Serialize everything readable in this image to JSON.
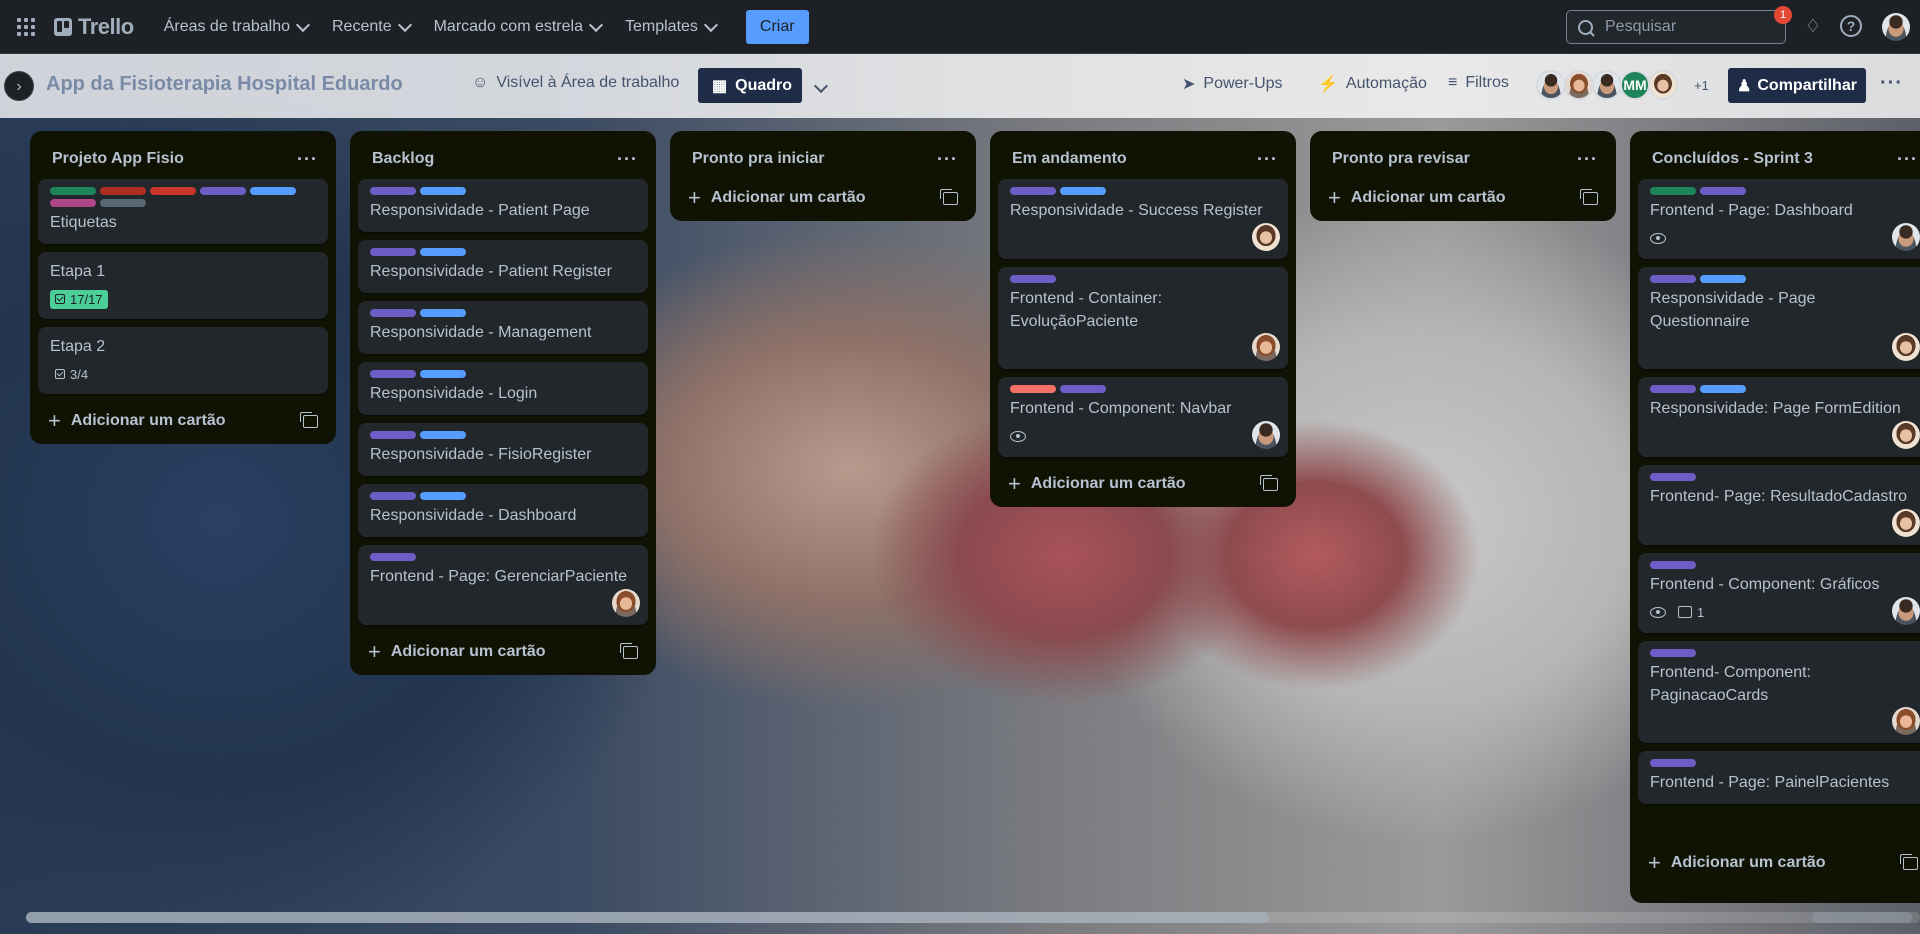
{
  "topbar": {
    "brand": "Trello",
    "nav": [
      "Áreas de trabalho",
      "Recente",
      "Marcado com estrela",
      "Templates"
    ],
    "create_label": "Criar",
    "search_placeholder": "Pesquisar",
    "notifications_count": "1"
  },
  "board": {
    "title": "App da Fisioterapia Hospital Eduardo",
    "visibility": "Visível à Área de trabalho",
    "view": "Quadro",
    "powerups": "Power-Ups",
    "automation": "Automação",
    "filters": "Filtros",
    "members_initials": "MM",
    "members_more": "+1",
    "share": "Compartilhar"
  },
  "colors": {
    "green": "#1f845a",
    "red_dark": "#ae2e24",
    "red": "#c9372c",
    "purple": "#6e5dc6",
    "blue": "#579dff",
    "magenta": "#ae4787",
    "gray": "#596773",
    "coral": "#f87168"
  },
  "add_card_label": "Adicionar um cartão",
  "lists": [
    {
      "title": "Projeto App Fisio",
      "cards": [
        {
          "title": "Etiquetas",
          "labels": [
            "green",
            "red_dark",
            "red",
            "purple",
            "blue",
            "magenta",
            "gray"
          ]
        },
        {
          "title": "Etapa 1",
          "checklist": "17/17",
          "checklist_done": true
        },
        {
          "title": "Etapa 2",
          "checklist": "3/4"
        }
      ]
    },
    {
      "title": "Backlog",
      "cards": [
        {
          "title": "Responsividade - Patient Page",
          "labels": [
            "purple",
            "blue"
          ]
        },
        {
          "title": "Responsividade - Patient Register",
          "labels": [
            "purple",
            "blue"
          ]
        },
        {
          "title": "Responsividade - Management",
          "labels": [
            "purple",
            "blue"
          ]
        },
        {
          "title": "Responsividade - Login",
          "labels": [
            "purple",
            "blue"
          ]
        },
        {
          "title": "Responsividade - FisioRegister",
          "labels": [
            "purple",
            "blue"
          ]
        },
        {
          "title": "Responsividade - Dashboard",
          "labels": [
            "purple",
            "blue"
          ]
        },
        {
          "title": "Frontend - Page: GerenciarPaciente",
          "labels": [
            "purple"
          ],
          "avatar": "female"
        }
      ]
    },
    {
      "title": "Pronto pra iniciar",
      "cards": []
    },
    {
      "title": "Em andamento",
      "cards": [
        {
          "title": "Responsividade - Success Register",
          "labels": [
            "purple",
            "blue"
          ],
          "avatar": "female2"
        },
        {
          "title": "Frontend - Container: EvoluçãoPaciente",
          "labels": [
            "purple"
          ],
          "avatar": "female"
        },
        {
          "title": "Frontend - Component: Navbar",
          "labels": [
            "coral",
            "purple"
          ],
          "watch": true,
          "avatar": "male"
        }
      ]
    },
    {
      "title": "Pronto pra revisar",
      "cards": []
    },
    {
      "title": "Concluídos - Sprint 3",
      "cards": [
        {
          "title": "Frontend - Page: Dashboard",
          "labels": [
            "green",
            "purple"
          ],
          "watch": true,
          "avatar": "male"
        },
        {
          "title": "Responsividade - Page Questionnaire",
          "labels": [
            "purple",
            "blue"
          ],
          "avatar": "female2"
        },
        {
          "title": "Responsividade: Page FormEdition",
          "labels": [
            "purple",
            "blue"
          ],
          "avatar": "female2"
        },
        {
          "title": "Frontend- Page: ResultadoCadastro",
          "labels": [
            "purple"
          ],
          "avatar": "female2"
        },
        {
          "title": "Frontend - Component: Gráficos",
          "labels": [
            "purple"
          ],
          "watch": true,
          "comments": "1",
          "avatar": "male"
        },
        {
          "title": "Frontend- Component: PaginacaoCards",
          "labels": [
            "purple"
          ],
          "avatar": "female"
        },
        {
          "title": "Frontend - Page: PainelPacientes",
          "labels": [
            "purple"
          ]
        }
      ]
    }
  ]
}
